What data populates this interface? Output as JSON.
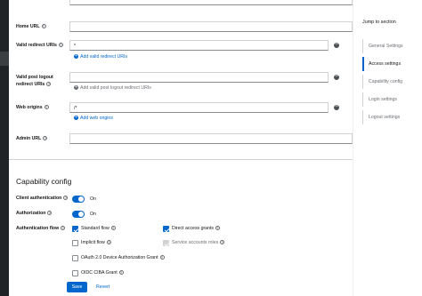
{
  "access_settings": {
    "home_url": {
      "label": "Home URL",
      "value": ""
    },
    "valid_redirect_uris": {
      "label": "Valid redirect URIs",
      "value": "*",
      "add_label": "Add valid redirect URIs"
    },
    "valid_post_logout": {
      "label_line1": "Valid post logout",
      "label_line2": "redirect URIs",
      "value": "",
      "add_label": "Add valid post logout redirect URIs"
    },
    "web_origins": {
      "label": "Web origins",
      "value": "/*",
      "add_label": "Add web origins"
    },
    "admin_url": {
      "label": "Admin URL",
      "value": ""
    }
  },
  "capability_config": {
    "title": "Capability config",
    "client_authentication": {
      "label": "Client authentication",
      "state": "On",
      "enabled": true
    },
    "authorization": {
      "label": "Authorization",
      "state": "On",
      "enabled": true
    },
    "authentication_flow": {
      "label": "Authentication flow",
      "options": [
        {
          "label": "Standard flow",
          "checked": true,
          "disabled": false
        },
        {
          "label": "Direct access grants",
          "checked": true,
          "disabled": false
        },
        {
          "label": "Implicit flow",
          "checked": false,
          "disabled": false
        },
        {
          "label": "Service accounts roles",
          "checked": true,
          "disabled": true
        },
        {
          "label": "OAuth 2.0 Device Authorization Grant",
          "checked": false,
          "disabled": false
        },
        {
          "label": "OIDC CIBA Grant",
          "checked": false,
          "disabled": false
        }
      ]
    }
  },
  "actions": {
    "save_label": "Save",
    "revert_label": "Revert"
  },
  "jump_to_section": {
    "title": "Jump to section",
    "items": [
      {
        "label": "General Settings",
        "active": false
      },
      {
        "label": "Access settings",
        "active": true
      },
      {
        "label": "Capability config",
        "active": false
      },
      {
        "label": "Login settings",
        "active": false
      },
      {
        "label": "Logout settings",
        "active": false
      }
    ]
  },
  "colors": {
    "accent": "#0066cc",
    "sidebar": "#212427",
    "text": "#151515",
    "muted": "#6a6e73"
  }
}
